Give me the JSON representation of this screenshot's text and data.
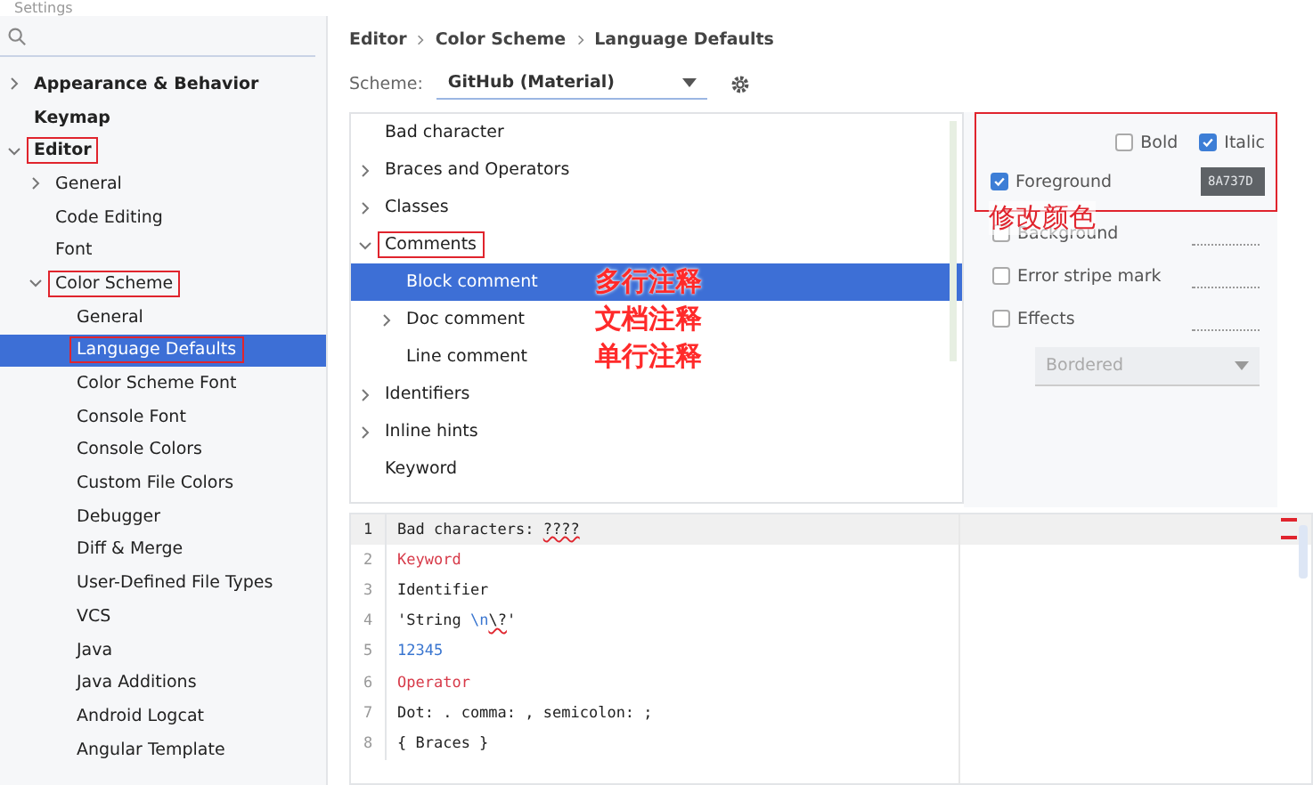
{
  "window": {
    "title": "Settings"
  },
  "sidebar": {
    "items": [
      {
        "label": "Appearance & Behavior",
        "bold": true,
        "expanded": false,
        "selected": false,
        "marked": false
      },
      {
        "label": "Keymap",
        "bold": true,
        "selected": false,
        "marked": false
      },
      {
        "label": "Editor",
        "bold": true,
        "expanded": true,
        "selected": false,
        "marked": true,
        "children": [
          {
            "label": "General",
            "expanded": false,
            "selected": false,
            "marked": false
          },
          {
            "label": "Code Editing",
            "selected": false,
            "marked": false
          },
          {
            "label": "Font",
            "selected": false,
            "marked": false
          },
          {
            "label": "Color Scheme",
            "expanded": true,
            "selected": false,
            "marked": true,
            "children": [
              {
                "label": "General",
                "selected": false,
                "marked": false
              },
              {
                "label": "Language Defaults",
                "selected": true,
                "marked": true
              },
              {
                "label": "Color Scheme Font",
                "selected": false,
                "marked": false
              },
              {
                "label": "Console Font",
                "selected": false,
                "marked": false
              },
              {
                "label": "Console Colors",
                "selected": false,
                "marked": false
              },
              {
                "label": "Custom File Colors",
                "selected": false,
                "marked": false
              },
              {
                "label": "Debugger",
                "selected": false,
                "marked": false
              },
              {
                "label": "Diff & Merge",
                "selected": false,
                "marked": false
              },
              {
                "label": "User-Defined File Types",
                "selected": false,
                "marked": false
              },
              {
                "label": "VCS",
                "selected": false,
                "marked": false
              },
              {
                "label": "Java",
                "selected": false,
                "marked": false
              },
              {
                "label": "Java Additions",
                "selected": false,
                "marked": false
              },
              {
                "label": "Android Logcat",
                "selected": false,
                "marked": false
              },
              {
                "label": "Angular Template",
                "selected": false,
                "marked": false
              }
            ]
          }
        ]
      }
    ]
  },
  "breadcrumb": [
    "Editor",
    "Color Scheme",
    "Language Defaults"
  ],
  "scheme": {
    "label": "Scheme:",
    "value": "GitHub (Material)"
  },
  "elements": [
    {
      "label": "Bad character",
      "selected": false,
      "marked": false
    },
    {
      "label": "Braces and Operators",
      "expanded": false,
      "selected": false,
      "marked": false
    },
    {
      "label": "Classes",
      "expanded": false,
      "selected": false,
      "marked": false
    },
    {
      "label": "Comments",
      "expanded": true,
      "selected": false,
      "marked": true,
      "children": [
        {
          "label": "Block comment",
          "selected": true,
          "marked": false
        },
        {
          "label": "Doc comment",
          "expanded": false,
          "selected": false,
          "marked": false
        },
        {
          "label": "Line comment",
          "selected": false,
          "marked": false
        }
      ]
    },
    {
      "label": "Identifiers",
      "expanded": false,
      "selected": false,
      "marked": false
    },
    {
      "label": "Inline hints",
      "expanded": false,
      "selected": false,
      "marked": false
    },
    {
      "label": "Keyword",
      "selected": false,
      "marked": false
    }
  ],
  "comment_notes": [
    "多行注释",
    "文档注释",
    "单行注释"
  ],
  "attributes": {
    "bold": {
      "label": "Bold",
      "checked": false
    },
    "italic": {
      "label": "Italic",
      "checked": true
    },
    "rows": [
      {
        "label": "Foreground",
        "checked": true,
        "value": "8A737D"
      },
      {
        "label": "Background",
        "checked": false
      },
      {
        "label": "Error stripe mark",
        "checked": false
      },
      {
        "label": "Effects",
        "checked": false
      }
    ],
    "effect": {
      "value": "Bordered",
      "disabled": true
    },
    "note": "修改颜色"
  },
  "preview": [
    {
      "number": "1",
      "current": true,
      "parts": [
        {
          "kind": "plain",
          "text": "Bad characters: "
        },
        {
          "kind": "bad",
          "text": "????"
        }
      ]
    },
    {
      "number": "2",
      "current": false,
      "parts": [
        {
          "kind": "keyword",
          "text": "Keyword"
        }
      ]
    },
    {
      "number": "3",
      "current": false,
      "parts": [
        {
          "kind": "plain",
          "text": "Identifier"
        }
      ]
    },
    {
      "number": "4",
      "current": false,
      "parts": [
        {
          "kind": "plain",
          "text": "'String "
        },
        {
          "kind": "escape",
          "text": "\\n"
        },
        {
          "kind": "bad",
          "text": "\\?"
        },
        {
          "kind": "plain",
          "text": "'"
        }
      ]
    },
    {
      "number": "5",
      "current": false,
      "parts": [
        {
          "kind": "number",
          "text": "12345"
        }
      ]
    },
    {
      "number": "6",
      "current": false,
      "parts": [
        {
          "kind": "keyword",
          "text": "Operator"
        }
      ]
    },
    {
      "number": "7",
      "current": false,
      "parts": [
        {
          "kind": "plain",
          "text": "Dot: . comma: , semicolon: ;"
        }
      ]
    },
    {
      "number": "8",
      "current": false,
      "parts": [
        {
          "kind": "plain",
          "text": "{ Braces }"
        }
      ]
    }
  ]
}
